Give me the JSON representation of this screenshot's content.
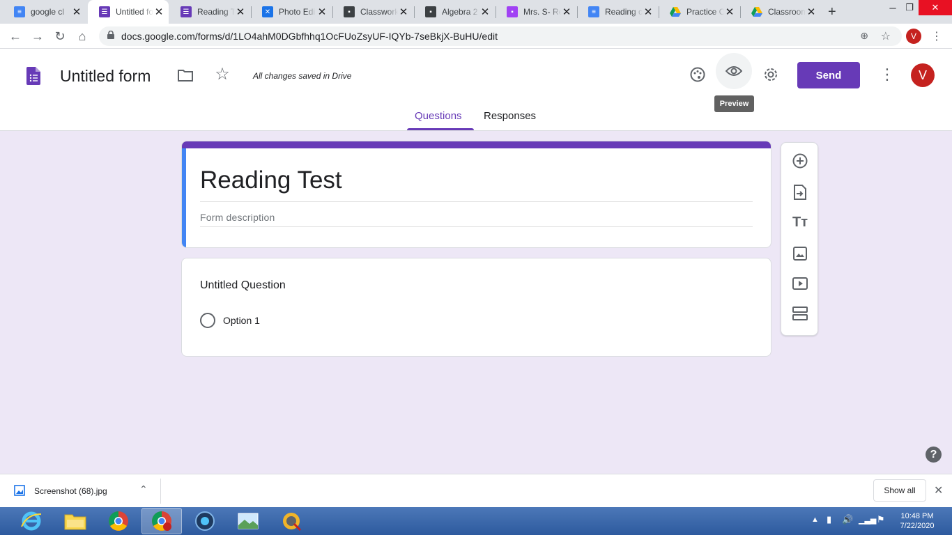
{
  "browser": {
    "tabs": [
      {
        "title": "google cl",
        "favicon": "docs-icon",
        "color": "#4285f4"
      },
      {
        "title": "Untitled fo",
        "favicon": "forms-icon",
        "color": "#673ab7",
        "active": true
      },
      {
        "title": "Reading T",
        "favicon": "forms-icon",
        "color": "#673ab7"
      },
      {
        "title": "Photo Edi",
        "favicon": "photo-editor-icon",
        "color": "#1a73e8"
      },
      {
        "title": "Classwork",
        "favicon": "classroom-icon",
        "color": "#3c4043"
      },
      {
        "title": "Algebra 2",
        "favicon": "classroom-icon",
        "color": "#3c4043"
      },
      {
        "title": "Mrs. S- Re",
        "favicon": "classroom-icon",
        "color": "#a142f4"
      },
      {
        "title": "Reading c",
        "favicon": "docs-icon",
        "color": "#4285f4"
      },
      {
        "title": "Practice C",
        "favicon": "drive-icon",
        "color": "#fbbc04"
      },
      {
        "title": "Classroom",
        "favicon": "drive-icon",
        "color": "#fbbc04"
      }
    ],
    "url": "docs.google.com/forms/d/1LO4ahM0DGbfhhq1OcFUoZsyUF-IQYb-7seBkjX-BuHU/edit",
    "profile_initial": "V"
  },
  "form_header": {
    "doc_title": "Untitled form",
    "save_status": "All changes saved in Drive",
    "send_label": "Send",
    "tooltip": "Preview",
    "avatar_initial": "V",
    "tabs": {
      "questions": "Questions",
      "responses": "Responses"
    }
  },
  "form": {
    "title": "Reading Test",
    "description_placeholder": "Form description",
    "question": {
      "title": "Untitled Question",
      "option": "Option 1"
    }
  },
  "download_bar": {
    "filename": "Screenshot (68).jpg",
    "show_all": "Show all"
  },
  "taskbar": {
    "time": "10:48 PM",
    "date": "7/22/2020"
  },
  "colors": {
    "accent": "#673ab7",
    "background": "#ede7f6",
    "title_bar_blue": "#4285f4"
  }
}
